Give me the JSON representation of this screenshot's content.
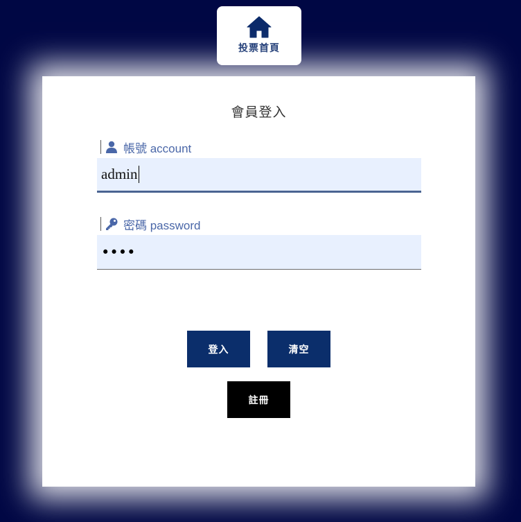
{
  "home": {
    "icon": "home-icon",
    "label": "投票首頁"
  },
  "login": {
    "title": "會員登入",
    "account": {
      "icon": "user-icon",
      "label": "帳號 account",
      "value": "admin"
    },
    "password": {
      "icon": "key-icon",
      "label": "密碼 password",
      "masked_value": "••••"
    },
    "buttons": {
      "login": "登入",
      "clear": "清空",
      "register": "註冊"
    }
  },
  "colors": {
    "background": "#000744",
    "accent": "#0b2e6b",
    "label": "#4a67a8",
    "input_bg": "#e8f0fe"
  }
}
